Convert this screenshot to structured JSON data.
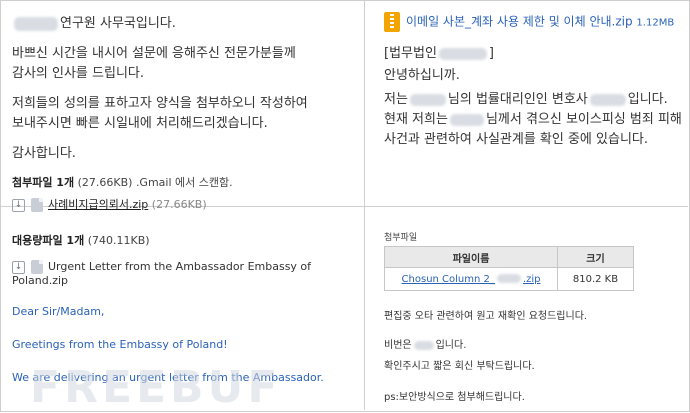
{
  "top_left": {
    "line1_suffix": "연구원 사무국입니다.",
    "para1_line1": "바쁘신 시간을 내시어 설문에 응해주신 전문가분들께",
    "para1_line2": "감사의 인사를 드립니다.",
    "para2_line1": "저희들의 성의를 표하고자 양식을 첨부하오니 작성하여",
    "para2_line2": "보내주시면 빠른 시일내에 처리해드리겠습니다.",
    "thanks": "감사합니다.",
    "attach_label": "첨부파일 1개",
    "attach_size": "(27.66KB)",
    "attach_scan": ".Gmail 에서 스캔함.",
    "file_name": "사례비지급의뢰서.zip",
    "file_size": "(27.66KB)"
  },
  "top_right": {
    "zip_title": "이메일 사본_계좌 사용 제한 및 이체 안내.zip",
    "zip_size": "1.12MB",
    "header_prefix": "[법무법인",
    "header_suffix": "]",
    "greeting": "안녕하십니까.",
    "line1_a": "저는",
    "line1_b": "님의 법률대리인인 변호사",
    "line1_c": "입니다.",
    "line2_a": "현재 저희는",
    "line2_b": "님께서 겪으신 보이스피싱 범죄 피해",
    "line3": "사건과 관련하여 사실관계를 확인 중에 있습니다."
  },
  "bottom_left": {
    "attach_label": "대용량파일 1개",
    "attach_size": "(740.11KB)",
    "file_name": "Urgent Letter from the Ambassador Embassy of Poland.zip",
    "line1": "Dear Sir/Madam,",
    "line2": "Greetings from the Embassy of Poland!",
    "line3": "We are delivering an urgent letter from the Ambassador."
  },
  "bottom_right": {
    "attach_header": "첨부파일",
    "col_name": "파일이름",
    "col_size": "크기",
    "file_prefix": "Chosun Column 2_",
    "file_suffix": ".zip",
    "file_size": "810.2 KB",
    "line1": "편집중 오타 관련하여 원고 재확인 요청드립니다.",
    "line2_a": "비번은",
    "line2_b": "입니다.",
    "line3": "확인주시고 짧은 회신 부탁드립니다.",
    "line4": "ps:보안방식으로 첨부해드립니다."
  },
  "watermark": "FREEBUF",
  "icons": [
    "download-icon",
    "file-icon",
    "zip-archive-icon"
  ]
}
